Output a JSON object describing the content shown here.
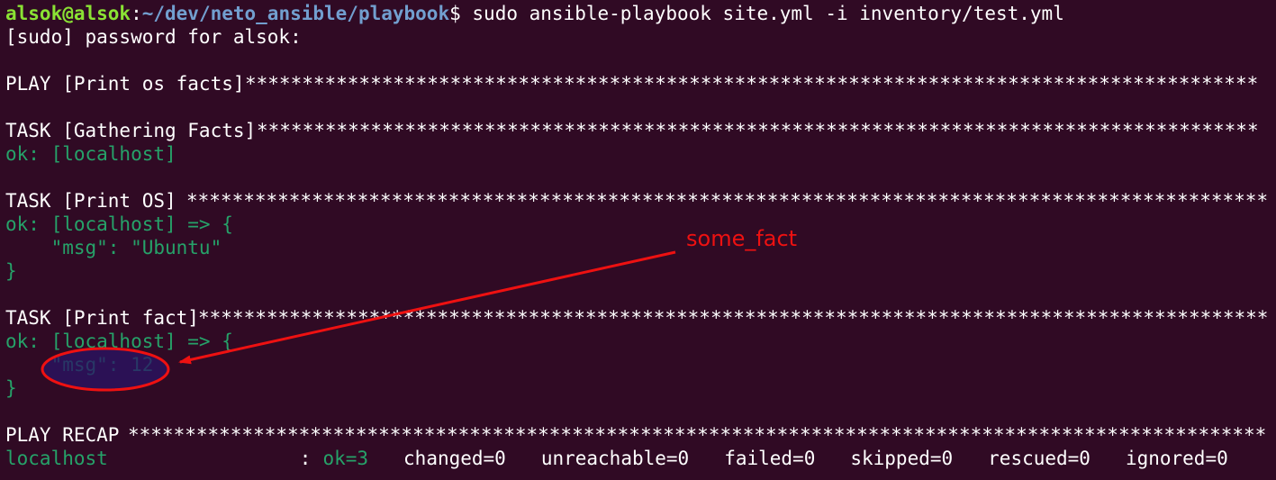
{
  "prompt": {
    "user_host": "alsok@alsok",
    "colon": ":",
    "path": "~/dev/neto_ansible/playbook",
    "dollar": "$",
    "command": " sudo ansible-playbook site.yml -i inventory/test.yml"
  },
  "sudo_prompt": "[sudo] password for alsok:",
  "play_header": "PLAY [Print os facts]",
  "task_gather": "TASK [Gathering Facts]",
  "gather_result": "ok: [localhost]",
  "task_os": "TASK [Print OS]",
  "os_result_open": "ok: [localhost] => {",
  "os_msg": "    \"msg\": \"Ubuntu\"",
  "os_result_close": "}",
  "task_fact": "TASK [Print fact]",
  "fact_result_open": "ok: [localhost] => {",
  "fact_msg": "    \"msg\": 12",
  "fact_result_close": "}",
  "recap_header": "PLAY RECAP",
  "recap": {
    "host": "localhost",
    "colon": ":",
    "ok": "ok=3",
    "changed": "changed=0",
    "unreachable": "unreachable=0",
    "failed": "failed=0",
    "skipped": "skipped=0",
    "rescued": "rescued=0",
    "ignored": "ignored=0"
  },
  "annotation": {
    "label": "some_fact"
  },
  "colors": {
    "background": "#300a24",
    "text": "#ffffff",
    "user": "#8ae234",
    "path": "#729fcf",
    "ok": "#26a269",
    "annotation": "#ee1111",
    "highlight": "#2a1466"
  },
  "star_char": "*"
}
